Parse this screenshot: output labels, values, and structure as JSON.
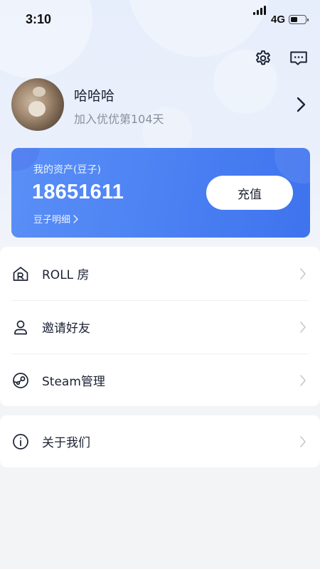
{
  "status_bar": {
    "time": "3:10",
    "network": "4G",
    "battery_level": 0.45
  },
  "header": {
    "settings_icon": "gear-icon",
    "message_icon": "message-icon"
  },
  "profile": {
    "username": "哈哈哈",
    "join_text": "加入优优第104天"
  },
  "assets": {
    "label": "我的资产(豆子)",
    "value": "18651611",
    "detail_link": "豆子明细",
    "recharge_label": "充值",
    "gradient_start": "#5a8ff7",
    "gradient_end": "#3f73ee"
  },
  "menu": {
    "items": [
      {
        "label": "ROLL 房",
        "icon": "roll-room-icon"
      },
      {
        "label": "邀请好友",
        "icon": "user-icon"
      },
      {
        "label": "Steam管理",
        "icon": "steam-icon"
      }
    ],
    "about": {
      "label": "关于我们",
      "icon": "info-icon"
    }
  }
}
